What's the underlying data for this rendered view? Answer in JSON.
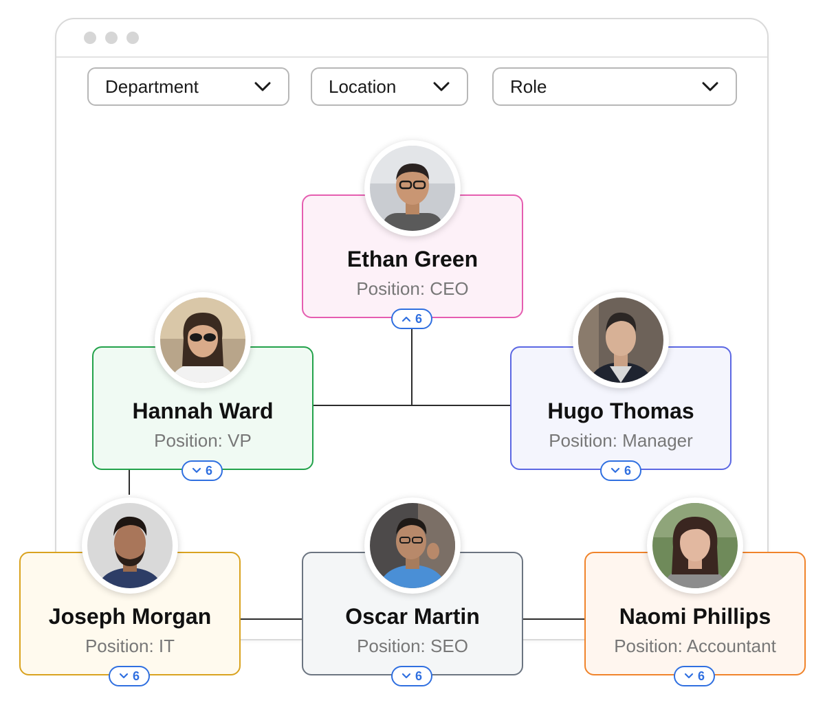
{
  "filters": [
    {
      "label": "Department"
    },
    {
      "label": "Location"
    },
    {
      "label": "Role"
    }
  ],
  "people": {
    "ceo": {
      "name": "Ethan Green",
      "position": "Position: CEO",
      "count": "6",
      "expanded": true
    },
    "vp": {
      "name": "Hannah Ward",
      "position": "Position: VP",
      "count": "6",
      "expanded": false
    },
    "manager": {
      "name": "Hugo Thomas",
      "position": "Position: Manager",
      "count": "6",
      "expanded": false
    },
    "it": {
      "name": "Joseph Morgan",
      "position": "Position: IT",
      "count": "6",
      "expanded": false
    },
    "seo": {
      "name": "Oscar Martin",
      "position": "Position: SEO",
      "count": "6",
      "expanded": false
    },
    "accountant": {
      "name": "Naomi Phillips",
      "position": "Position: Accountant",
      "count": "6",
      "expanded": false
    }
  },
  "colors": {
    "ceo_border": "#e55db0",
    "ceo_bg": "#fdf1f8",
    "vp_border": "#22a24a",
    "vp_bg": "#f0faf3",
    "manager_border": "#5b67e3",
    "manager_bg": "#f4f5fd",
    "it_border": "#d9a21e",
    "it_bg": "#fffaee",
    "seo_border": "#6b7480",
    "seo_bg": "#f4f6f7",
    "accountant_border": "#f0832a",
    "accountant_bg": "#fff6ef",
    "badge": "#2f6fe0"
  }
}
